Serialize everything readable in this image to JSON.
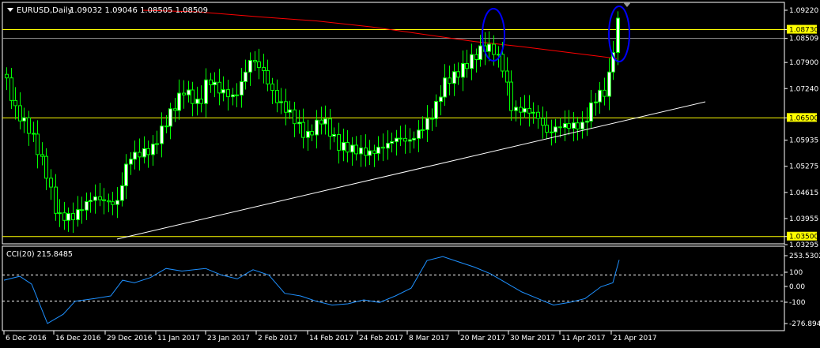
{
  "header": {
    "symbol": "EURUSD,Daily",
    "ohlc": "1.09032 1.09046 1.08505 1.08509"
  },
  "price_axis": {
    "labels": [
      "1.09220",
      "1.08730",
      "1.08509",
      "1.07900",
      "1.07240",
      "1.06500",
      "1.05935",
      "1.05275",
      "1.04615",
      "1.03955",
      "1.03500",
      "1.03295"
    ],
    "highlighted": [
      "1.08730",
      "1.06500",
      "1.03500"
    ]
  },
  "hlines": {
    "price_line": "1.08509",
    "levels": [
      "1.08730",
      "1.06500",
      "1.03500"
    ]
  },
  "indicator": {
    "title": "CCI(20) 215.8485",
    "axis_labels": [
      "253.5302",
      "100",
      "0.00",
      "-100",
      "-276.8944"
    ],
    "levels": [
      100,
      -100
    ]
  },
  "time_axis": {
    "labels": [
      "6 Dec 2016",
      "16 Dec 2016",
      "29 Dec 2016",
      "11 Jan 2017",
      "23 Jan 2017",
      "2 Feb 2017",
      "14 Feb 2017",
      "24 Feb 2017",
      "8 Mar 2017",
      "20 Mar 2017",
      "30 Mar 2017",
      "11 Apr 2017",
      "21 Apr 2017"
    ]
  },
  "colors": {
    "background": "#000000",
    "frame": "#ffffff",
    "candle_bull": "#ffffff",
    "candle_bear": "#000000",
    "candle_wick": "#00ff00",
    "moving_average": "#ff0000",
    "level_line": "#ffff00",
    "trend_line": "#ffffff",
    "highlight_circle": "#0000ff",
    "cci_line": "#1e90ff",
    "axis_text": "#ffffff",
    "highlight_label_bg": "#ffff00"
  }
}
